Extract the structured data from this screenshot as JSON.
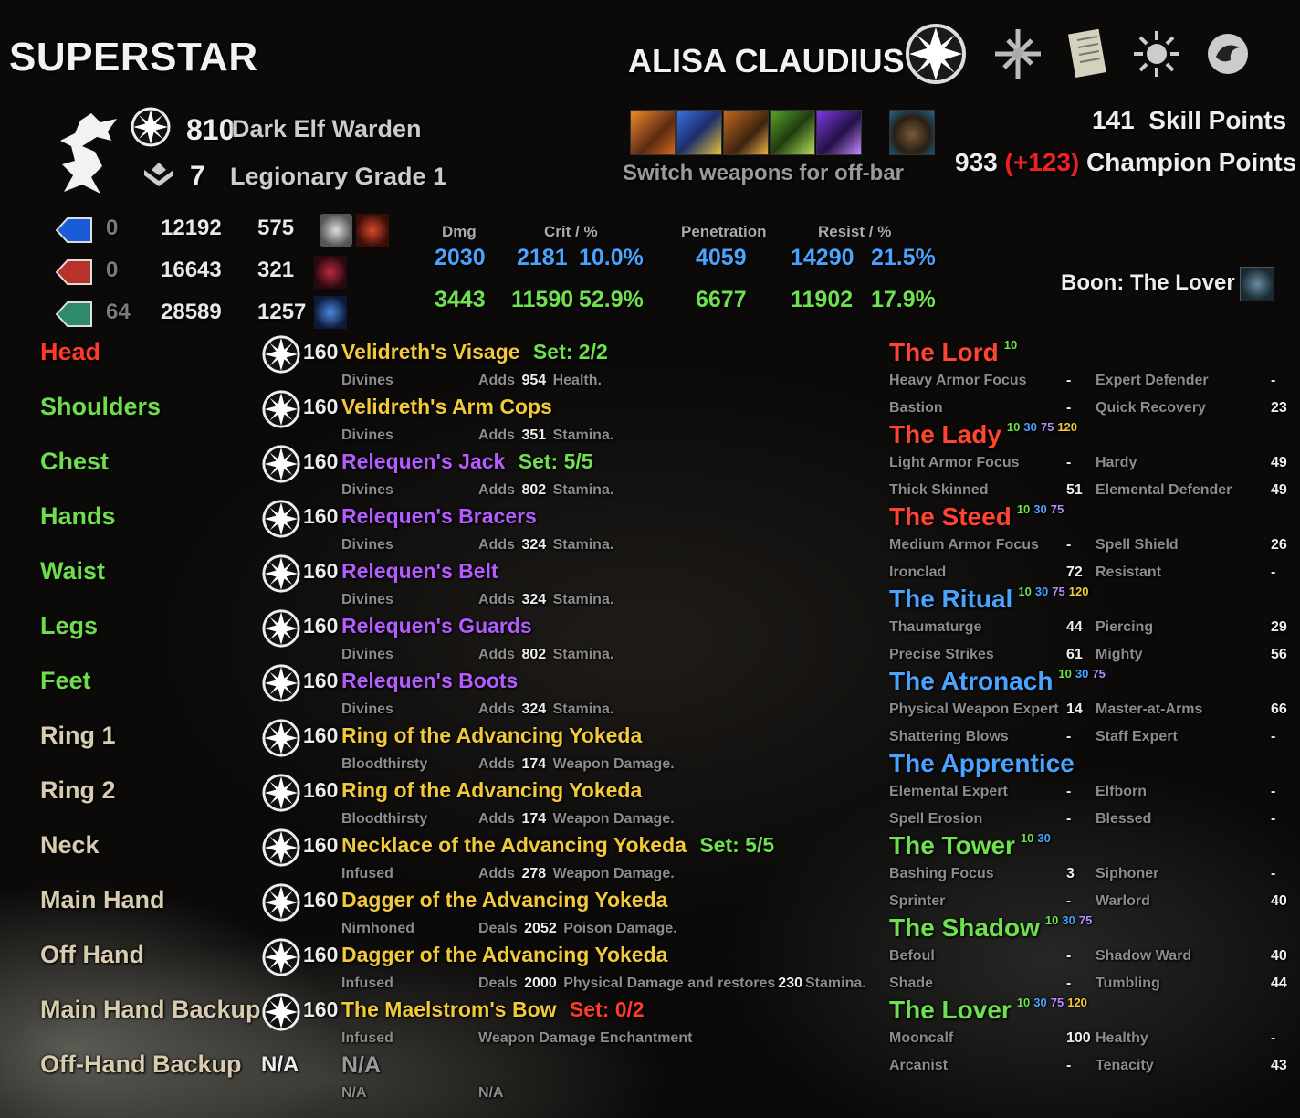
{
  "title": "SUPERSTAR",
  "character": {
    "name": "ALISA CLAUDIUS",
    "cp_level": "810",
    "race_class": "Dark Elf Warden",
    "rank_number": "7",
    "rank_text": "Legionary Grade 1"
  },
  "tabs": [
    "champion-icon",
    "skills-icon",
    "scroll-icon",
    "sun-icon",
    "swirl-icon"
  ],
  "skillbar_note": "Switch weapons for off-bar",
  "points": {
    "skill_value": "141",
    "skill_label": "Skill Points",
    "champion_value": "933",
    "champion_bonus": "(+123)",
    "champion_label": "Champion Points"
  },
  "resources": [
    {
      "name": "magicka",
      "color": "#1a5bd6",
      "base": "0",
      "max": "12192",
      "regen": "575"
    },
    {
      "name": "health",
      "color": "#b8322a",
      "base": "0",
      "max": "16643",
      "regen": "321"
    },
    {
      "name": "stamina",
      "color": "#2f8a6a",
      "base": "64",
      "max": "28589",
      "regen": "1257"
    }
  ],
  "stats": {
    "headers": {
      "dmg": "Dmg",
      "crit": "Crit / %",
      "pen": "Penetration",
      "resist": "Resist / %"
    },
    "spell": {
      "dmg": "2030",
      "crit": "2181",
      "crit_pct": "10.0%",
      "pen": "4059",
      "resist": "14290",
      "resist_pct": "21.5%"
    },
    "weapon": {
      "dmg": "3443",
      "crit": "11590",
      "crit_pct": "52.9%",
      "pen": "6677",
      "resist": "11902",
      "resist_pct": "17.9%"
    }
  },
  "boon": "Boon: The Lover",
  "equipment": [
    {
      "slot": "Head",
      "level": "160",
      "item": "Velidreth's Visage",
      "set": "Set: 2/2",
      "trait": "Divines",
      "ench_pre": "Adds",
      "ench_val": "954",
      "ench_post": "Health."
    },
    {
      "slot": "Shoulders",
      "level": "160",
      "item": "Velidreth's Arm Cops",
      "set": "",
      "trait": "Divines",
      "ench_pre": "Adds",
      "ench_val": "351",
      "ench_post": "Stamina."
    },
    {
      "slot": "Chest",
      "level": "160",
      "item": "Relequen's Jack",
      "set": "Set: 5/5",
      "trait": "Divines",
      "ench_pre": "Adds",
      "ench_val": "802",
      "ench_post": "Stamina."
    },
    {
      "slot": "Hands",
      "level": "160",
      "item": "Relequen's Bracers",
      "set": "",
      "trait": "Divines",
      "ench_pre": "Adds",
      "ench_val": "324",
      "ench_post": "Stamina."
    },
    {
      "slot": "Waist",
      "level": "160",
      "item": "Relequen's Belt",
      "set": "",
      "trait": "Divines",
      "ench_pre": "Adds",
      "ench_val": "324",
      "ench_post": "Stamina."
    },
    {
      "slot": "Legs",
      "level": "160",
      "item": "Relequen's Guards",
      "set": "",
      "trait": "Divines",
      "ench_pre": "Adds",
      "ench_val": "802",
      "ench_post": "Stamina."
    },
    {
      "slot": "Feet",
      "level": "160",
      "item": "Relequen's Boots",
      "set": "",
      "trait": "Divines",
      "ench_pre": "Adds",
      "ench_val": "324",
      "ench_post": "Stamina."
    },
    {
      "slot": "Ring 1",
      "level": "160",
      "item": "Ring of the Advancing Yokeda",
      "set": "",
      "trait": "Bloodthirsty",
      "ench_pre": "Adds",
      "ench_val": "174",
      "ench_post": "Weapon Damage."
    },
    {
      "slot": "Ring 2",
      "level": "160",
      "item": "Ring of the Advancing Yokeda",
      "set": "",
      "trait": "Bloodthirsty",
      "ench_pre": "Adds",
      "ench_val": "174",
      "ench_post": "Weapon Damage."
    },
    {
      "slot": "Neck",
      "level": "160",
      "item": "Necklace of the Advancing Yokeda",
      "set": "Set: 5/5",
      "trait": "Infused",
      "ench_pre": "Adds",
      "ench_val": "278",
      "ench_post": "Weapon Damage."
    },
    {
      "slot": "Main Hand",
      "level": "160",
      "item": "Dagger of the Advancing Yokeda",
      "set": "",
      "trait": "Nirnhoned",
      "ench_pre": "Deals",
      "ench_val": "2052",
      "ench_post": "Poison Damage."
    },
    {
      "slot": "Off Hand",
      "level": "160",
      "item": "Dagger of the Advancing Yokeda",
      "set": "",
      "trait": "Infused",
      "ench_pre": "Deals",
      "ench_val": "2000",
      "ench_post": "Physical Damage and restores",
      "ench_val2": "230",
      "ench_post2": "Stamina."
    },
    {
      "slot": "Main Hand Backup",
      "level": "160",
      "item": "The Maelstrom's Bow",
      "set": "Set: 0/2",
      "trait": "Infused",
      "ench_pre": "Weapon Damage Enchantment",
      "ench_val": "",
      "ench_post": ""
    },
    {
      "slot": "Off-Hand Backup",
      "level": "N/A",
      "item": "N/A",
      "set": "",
      "trait": "N/A",
      "ench_pre": "N/A",
      "ench_val": "",
      "ench_post": ""
    }
  ],
  "constellations": [
    {
      "name": "The Lord",
      "sup": [
        "10"
      ]
    },
    {
      "name": "The Lady",
      "sup": [
        "10",
        "30",
        "75",
        "120"
      ]
    },
    {
      "name": "The Steed",
      "sup": [
        "10",
        "30",
        "75"
      ]
    },
    {
      "name": "The Ritual",
      "sup": [
        "10",
        "30",
        "75",
        "120"
      ]
    },
    {
      "name": "The Atronach",
      "sup": [
        "10",
        "30",
        "75"
      ]
    },
    {
      "name": "The Apprentice",
      "sup": []
    },
    {
      "name": "The Tower",
      "sup": [
        "10",
        "30"
      ]
    },
    {
      "name": "The Shadow",
      "sup": [
        "10",
        "30",
        "75"
      ]
    },
    {
      "name": "The Lover",
      "sup": [
        "10",
        "30",
        "75",
        "120"
      ]
    }
  ],
  "stars": [
    {
      "l": "Heavy Armor Focus",
      "lv": "-",
      "r": "Expert Defender",
      "rv": "-"
    },
    {
      "l": "Bastion",
      "lv": "-",
      "r": "Quick Recovery",
      "rv": "23"
    },
    {
      "l": "Light Armor Focus",
      "lv": "-",
      "r": "Hardy",
      "rv": "49"
    },
    {
      "l": "Thick Skinned",
      "lv": "51",
      "r": "Elemental Defender",
      "rv": "49"
    },
    {
      "l": "Medium Armor Focus",
      "lv": "-",
      "r": "Spell Shield",
      "rv": "26"
    },
    {
      "l": "Ironclad",
      "lv": "72",
      "r": "Resistant",
      "rv": "-"
    },
    {
      "l": "Thaumaturge",
      "lv": "44",
      "r": "Piercing",
      "rv": "29"
    },
    {
      "l": "Precise Strikes",
      "lv": "61",
      "r": "Mighty",
      "rv": "56"
    },
    {
      "l": "Physical Weapon Expert",
      "lv": "14",
      "r": "Master-at-Arms",
      "rv": "66"
    },
    {
      "l": "Shattering Blows",
      "lv": "-",
      "r": "Staff Expert",
      "rv": "-"
    },
    {
      "l": "Elemental Expert",
      "lv": "-",
      "r": "Elfborn",
      "rv": "-"
    },
    {
      "l": "Spell Erosion",
      "lv": "-",
      "r": "Blessed",
      "rv": "-"
    },
    {
      "l": "Bashing Focus",
      "lv": "3",
      "r": "Siphoner",
      "rv": "-"
    },
    {
      "l": "Sprinter",
      "lv": "-",
      "r": "Warlord",
      "rv": "40"
    },
    {
      "l": "Befoul",
      "lv": "-",
      "r": "Shadow Ward",
      "rv": "40"
    },
    {
      "l": "Shade",
      "lv": "-",
      "r": "Tumbling",
      "rv": "44"
    },
    {
      "l": "Mooncalf",
      "lv": "100",
      "r": "Healthy",
      "rv": "-"
    },
    {
      "l": "Arcanist",
      "lv": "-",
      "r": "Tenacity",
      "rv": "43"
    }
  ],
  "colors": {
    "gold": "#f1c93b",
    "purple": "#b45cff",
    "set_green": "#6fe04f",
    "red": "#ff3b2a",
    "blue": "#4aa3ff"
  }
}
